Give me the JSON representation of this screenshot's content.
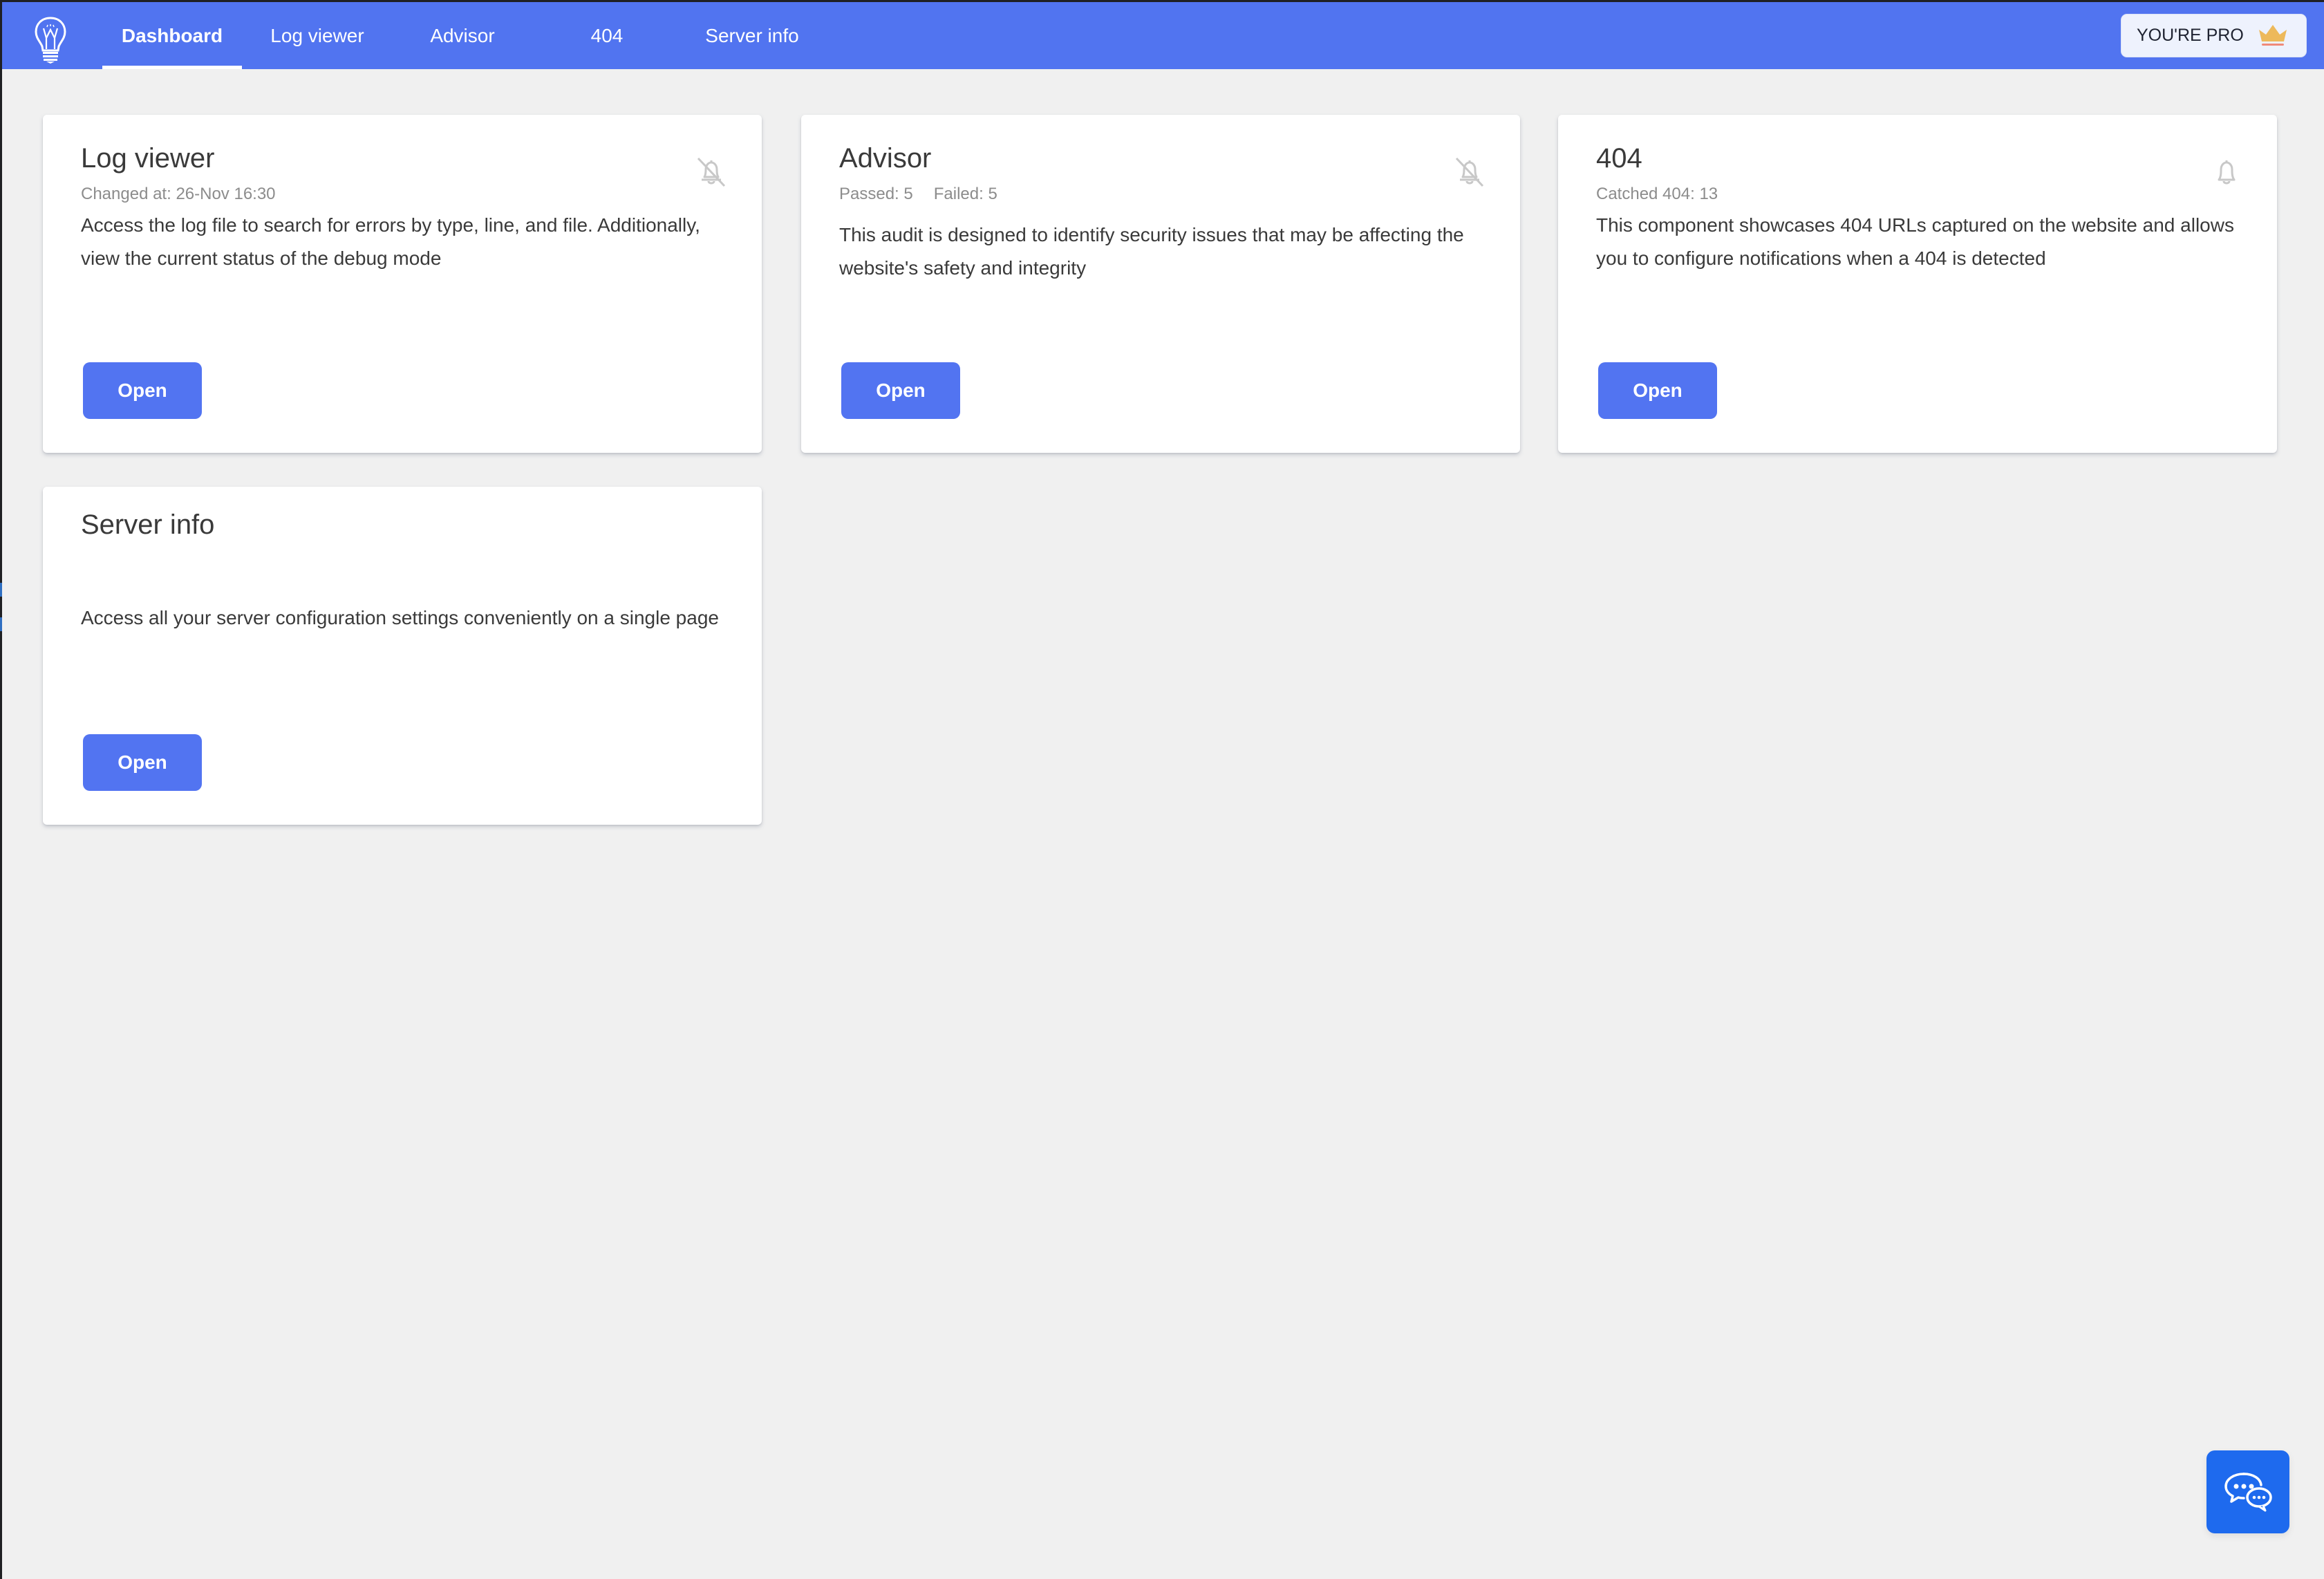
{
  "nav": {
    "items": [
      {
        "label": "Dashboard",
        "active": true
      },
      {
        "label": "Log viewer",
        "active": false
      },
      {
        "label": "Advisor",
        "active": false
      },
      {
        "label": "404",
        "active": false
      },
      {
        "label": "Server info",
        "active": false
      }
    ],
    "pro_badge": {
      "label": "YOU'RE PRO",
      "icon": "crown-icon"
    },
    "logo_icon": "lightbulb-icon"
  },
  "cards": [
    {
      "title": "Log viewer",
      "subtitle": "Changed at: 26-Nov 16:30",
      "description": "Access the log file to search for errors by type, line, and file. Additionally, view the current status of the debug mode",
      "notification_icon": "bell-off-icon",
      "button_label": "Open"
    },
    {
      "title": "Advisor",
      "passed": "Passed: 5",
      "failed": "Failed: 5",
      "description": "This audit is designed to identify security issues that may be affecting the website's safety and integrity",
      "notification_icon": "bell-off-icon",
      "button_label": "Open"
    },
    {
      "title": "404",
      "subtitle": "Catched 404: 13",
      "description": "This component showcases 404 URLs captured on the website and allows you to configure notifications when a 404 is detected",
      "notification_icon": "bell-icon",
      "button_label": "Open"
    },
    {
      "title": "Server info",
      "description": "Access all your server configuration settings conveniently on a single page",
      "button_label": "Open"
    }
  ],
  "chat": {
    "icon": "chat-bubbles-icon"
  },
  "colors": {
    "nav_bg": "#5174F0",
    "button_bg": "#5274F1",
    "chat_bg": "#1E6AEE",
    "page_bg": "#F0F0F0",
    "crown": "#EDB95B"
  }
}
